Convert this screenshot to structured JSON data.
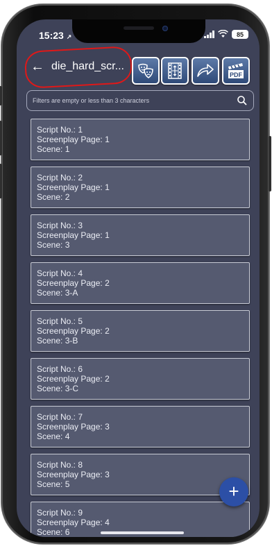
{
  "status_bar": {
    "time": "15:23",
    "location_arrow": "↗",
    "battery_level": "85"
  },
  "app_bar": {
    "back_glyph": "←",
    "title": "die_hard_scr...",
    "actions": [
      {
        "name": "characters-button",
        "icon": "theater-masks-icon"
      },
      {
        "name": "filmstrip-button",
        "icon": "filmstrip-icon"
      },
      {
        "name": "share-button",
        "icon": "share-arrow-icon"
      },
      {
        "name": "pdf-button",
        "icon": "pdf-clapper-icon"
      }
    ]
  },
  "search": {
    "value": "",
    "placeholder": "Filters are empty or less than 3 characters"
  },
  "scenes": [
    {
      "script_no": "Script No.: 1",
      "page": "Screenplay Page: 1",
      "scene": "Scene: 1"
    },
    {
      "script_no": "Script No.: 2",
      "page": "Screenplay Page: 1",
      "scene": "Scene: 2"
    },
    {
      "script_no": "Script No.: 3",
      "page": "Screenplay Page: 1",
      "scene": "Scene: 3"
    },
    {
      "script_no": "Script No.: 4",
      "page": "Screenplay Page: 2",
      "scene": "Scene: 3-A"
    },
    {
      "script_no": "Script No.: 5",
      "page": "Screenplay Page: 2",
      "scene": "Scene: 3-B"
    },
    {
      "script_no": "Script No.: 6",
      "page": "Screenplay Page: 2",
      "scene": "Scene: 3-C"
    },
    {
      "script_no": "Script No.: 7",
      "page": "Screenplay Page: 3",
      "scene": "Scene: 4"
    },
    {
      "script_no": "Script No.: 8",
      "page": "Screenplay Page: 3",
      "scene": "Scene: 5"
    },
    {
      "script_no": "Script No.: 9",
      "page": "Screenplay Page: 4",
      "scene": "Scene: 6"
    }
  ],
  "fab": {
    "label": "+"
  },
  "colors": {
    "background": "#3e4258",
    "card": "#555a70",
    "accent": "#2c4fa6",
    "highlight": "#e01818"
  }
}
